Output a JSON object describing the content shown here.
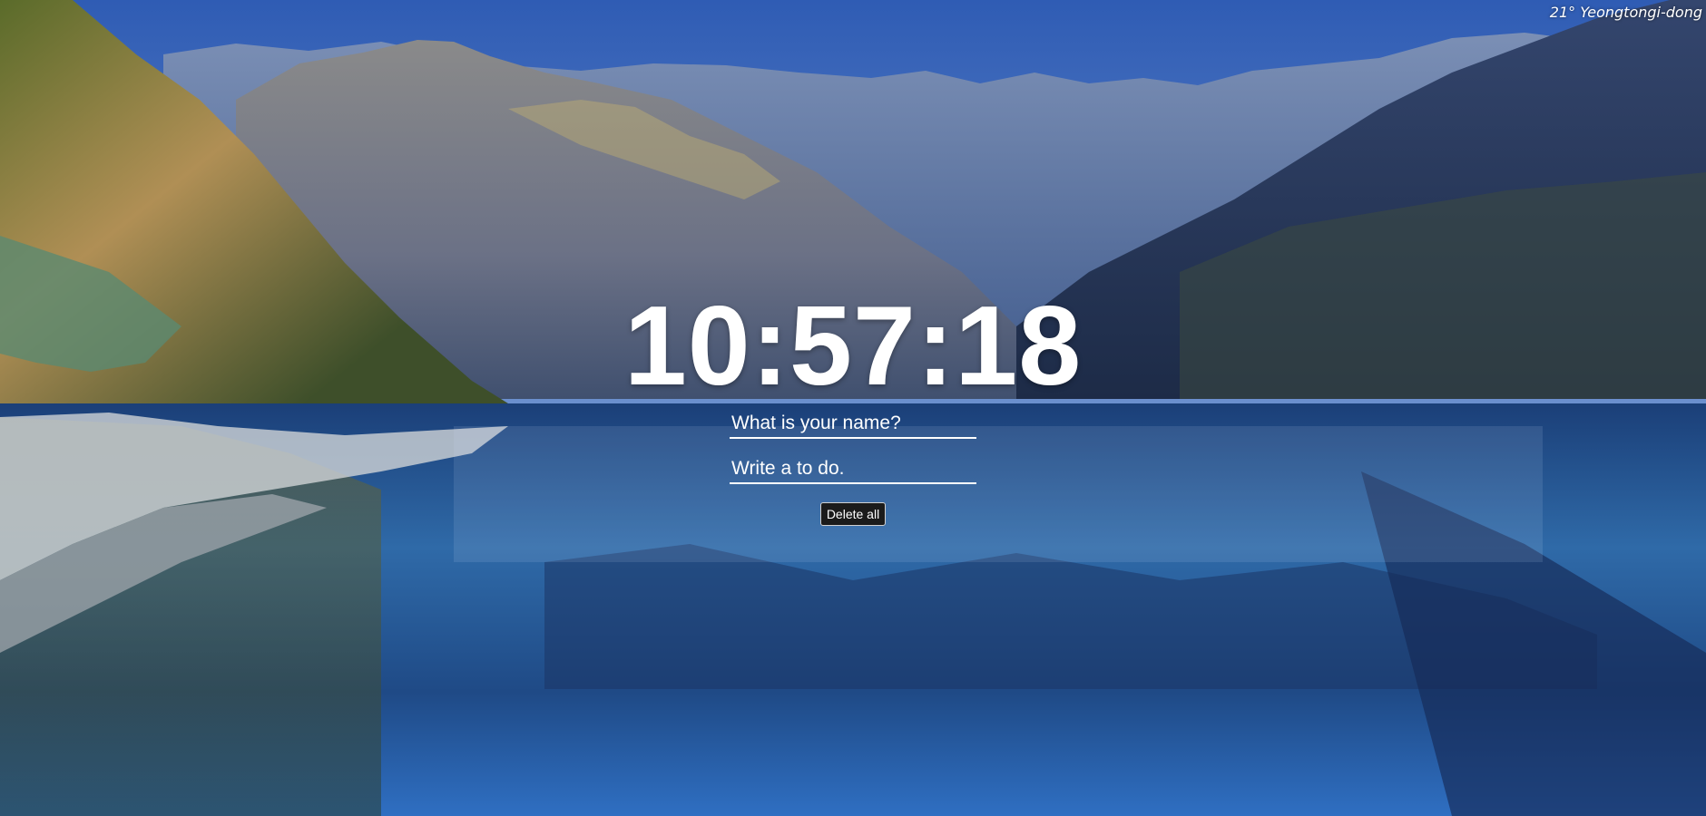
{
  "weather": {
    "text": "21° Yeongtongi-dong"
  },
  "clock": {
    "time": "10:57:18"
  },
  "name_form": {
    "placeholder": "What is your name?"
  },
  "todo_form": {
    "placeholder": "Write a to do."
  },
  "actions": {
    "delete_all_label": "Delete all"
  },
  "colors": {
    "sky_top": "#3b64b8",
    "sky_bottom": "#a8c2e6",
    "lake": "#234f8f",
    "text": "#ffffff",
    "button_bg": "#1b1b1b"
  }
}
